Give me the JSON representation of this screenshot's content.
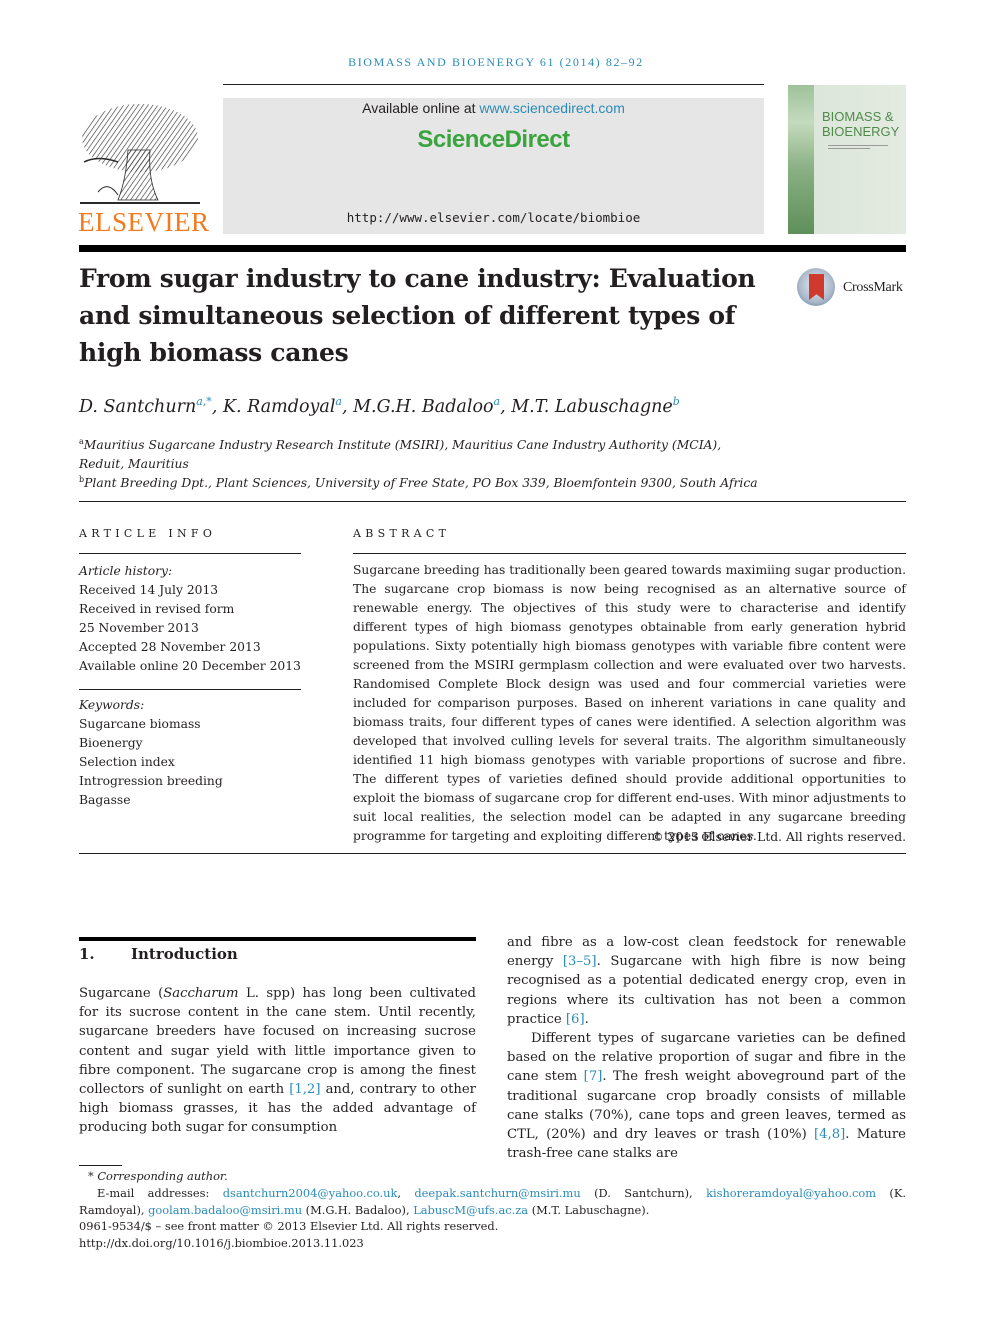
{
  "journal": {
    "citation_line": "BIOMASS AND BIOENERGY 61 (2014) 82–92",
    "publisher": "ELSEVIER",
    "available_online_prefix": "Available online at ",
    "available_online_link": "www.sciencedirect.com",
    "sciencedirect": "ScienceDirect",
    "journal_url": "http://www.elsevier.com/locate/biombioe",
    "cover_title_line1": "BIOMASS &",
    "cover_title_line2": "BIOENERGY",
    "crossmark": "CrossMark"
  },
  "article": {
    "title": "From sugar industry to cane industry: Evaluation and simultaneous selection of different types of high biomass canes",
    "authors": [
      {
        "name": "D. Santchurn",
        "sup": "a,*"
      },
      {
        "name": "K. Ramdoyal",
        "sup": "a"
      },
      {
        "name": "M.G.H. Badaloo",
        "sup": "a"
      },
      {
        "name": "M.T. Labuschagne",
        "sup": "b"
      }
    ],
    "affiliations": [
      {
        "key": "a",
        "text": "Mauritius Sugarcane Industry Research Institute (MSIRI), Mauritius Cane Industry Authority (MCIA), Reduit, Mauritius"
      },
      {
        "key": "b",
        "text": "Plant Breeding Dpt., Plant Sciences, University of Free State, PO Box 339, Bloemfontein 9300, South Africa"
      }
    ]
  },
  "article_info": {
    "heading": "ARTICLE INFO",
    "history_label": "Article history:",
    "history": [
      "Received 14 July 2013",
      "Received in revised form",
      "25 November 2013",
      "Accepted 28 November 2013",
      "Available online 20 December 2013"
    ],
    "keywords_label": "Keywords:",
    "keywords": [
      "Sugarcane biomass",
      "Bioenergy",
      "Selection index",
      "Introgression breeding",
      "Bagasse"
    ]
  },
  "abstract": {
    "heading": "ABSTRACT",
    "text": "Sugarcane breeding has traditionally been geared towards maximiing sugar production. The sugarcane crop biomass is now being recognised as an alternative source of renewable energy. The objectives of this study were to characterise and identify different types of high biomass genotypes obtainable from early generation hybrid populations. Sixty potentially high biomass genotypes with variable fibre content were screened from the MSIRI germplasm collection and were evaluated over two harvests. Randomised Complete Block design was used and four commercial varieties were included for comparison purposes. Based on inherent variations in cane quality and biomass traits, four different types of canes were identified. A selection algorithm was developed that involved culling levels for several traits. The algorithm simultaneously identified 11 high biomass genotypes with variable proportions of sucrose and fibre. The different types of varieties defined should provide additional opportunities to exploit the biomass of sugarcane crop for different end-uses. With minor adjustments to suit local realities, the selection model can be adapted in any sugarcane breeding programme for targeting and exploiting different types of canes.",
    "copyright": "© 2013 Elsevier Ltd. All rights reserved."
  },
  "body": {
    "section_number": "1.",
    "section_title": "Introduction",
    "left_p1_a": "Sugarcane (",
    "left_p1_italic": "Saccharum",
    "left_p1_b": " L. spp) has long been cultivated for its sucrose content in the cane stem. Until recently, sugarcane breeders have focused on increasing sucrose content and sugar yield with little importance given to fibre component. The sugarcane crop is among the finest collectors of sunlight on earth ",
    "left_p1_ref": "[1,2]",
    "left_p1_c": " and, contrary to other high biomass grasses, it has the added advantage of producing both sugar for consumption",
    "right_p1_a": "and fibre as a low-cost clean feedstock for renewable energy ",
    "right_p1_ref1": "[3–5]",
    "right_p1_b": ". Sugarcane with high fibre is now being recognised as a potential dedicated energy crop, even in regions where its cultivation has not been a common practice ",
    "right_p1_ref2": "[6]",
    "right_p1_c": ".",
    "right_p2_a": "Different types of sugarcane varieties can be defined based on the relative proportion of sugar and fibre in the cane stem ",
    "right_p2_ref1": "[7]",
    "right_p2_b": ". The fresh weight aboveground part of the traditional sugarcane crop broadly consists of millable cane stalks (70%), cane tops and green leaves, termed as CTL, (20%) and dry leaves or trash (10%) ",
    "right_p2_ref2": "[4,8]",
    "right_p2_c": ". Mature trash-free cane stalks are"
  },
  "footnotes": {
    "corresponding": "* Corresponding author.",
    "email_label": "E-mail addresses: ",
    "emails": [
      {
        "addr": "dsantchurn2004@yahoo.co.uk",
        "after": ", "
      },
      {
        "addr": "deepak.santchurn@msiri.mu",
        "after": " (D. Santchurn), "
      },
      {
        "addr": "kishoreramdoyal@yahoo.com",
        "after": " (K. Ramdoyal), "
      },
      {
        "addr": "goolam.badaloo@msiri.mu",
        "after": " (M.G.H. Badaloo), "
      },
      {
        "addr": "LabuscM@ufs.ac.za",
        "after": " (M.T. Labuschagne)."
      }
    ],
    "issn": "0961-9534/$ – see front matter © 2013 Elsevier Ltd. All rights reserved.",
    "doi": "http://dx.doi.org/10.1016/j.biombioe.2013.11.023"
  },
  "colors": {
    "link": "#2a8bb8",
    "elsevier_orange": "#f47a20",
    "sciencedirect_green": "#3aa43f",
    "banner_gray": "#e6e6e6"
  }
}
